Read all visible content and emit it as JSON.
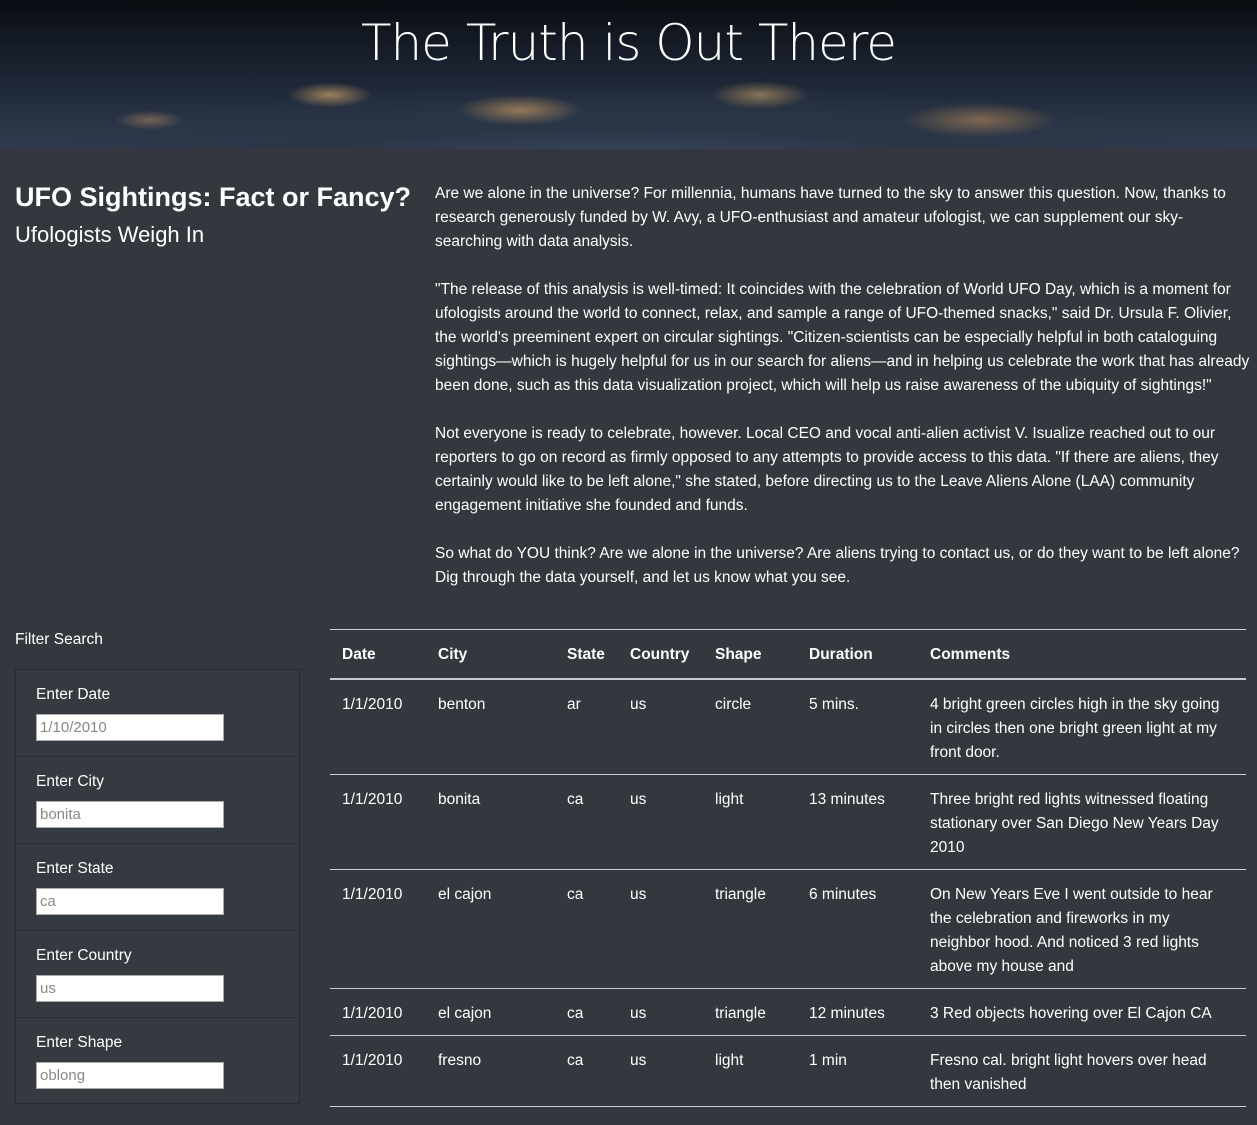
{
  "hero": {
    "title": "The Truth is Out There"
  },
  "article": {
    "title": "UFO Sightings: Fact or Fancy?",
    "subtitle": "Ufologists Weigh In",
    "paragraphs": [
      "Are we alone in the universe? For millennia, humans have turned to the sky to answer this question. Now, thanks to research generously funded by W. Avy, a UFO-enthusiast and amateur ufologist, we can supplement our sky-searching with data analysis.",
      "\"The release of this analysis is well-timed: It coincides with the celebration of World UFO Day, which is a moment for ufologists around the world to connect, relax, and sample a range of UFO-themed snacks,\" said Dr. Ursula F. Olivier, the world's preeminent expert on circular sightings. \"Citizen-scientists can be especially helpful in both cataloguing sightings—which is hugely helpful for us in our search for aliens—and in helping us celebrate the work that has already been done, such as this data visualization project, which will help us raise awareness of the ubiquity of sightings!\"",
      "Not everyone is ready to celebrate, however. Local CEO and vocal anti-alien activist V. Isualize reached out to our reporters to go on record as firmly opposed to any attempts to provide access to this data. \"If there are aliens, they certainly would like to be left alone,\" she stated, before directing us to the Leave Aliens Alone (LAA) community engagement initiative she founded and funds.",
      "So what do YOU think? Are we alone in the universe? Are aliens trying to contact us, or do they want to be left alone? Dig through the data yourself, and let us know what you see."
    ]
  },
  "filters": {
    "heading": "Filter Search",
    "items": [
      {
        "label": "Enter Date",
        "placeholder": "1/10/2010"
      },
      {
        "label": "Enter City",
        "placeholder": "bonita"
      },
      {
        "label": "Enter State",
        "placeholder": "ca"
      },
      {
        "label": "Enter Country",
        "placeholder": "us"
      },
      {
        "label": "Enter Shape",
        "placeholder": "oblong"
      }
    ]
  },
  "table": {
    "headers": [
      "Date",
      "City",
      "State",
      "Country",
      "Shape",
      "Duration",
      "Comments"
    ],
    "rows": [
      [
        "1/1/2010",
        "benton",
        "ar",
        "us",
        "circle",
        "5 mins.",
        "4 bright green circles high in the sky going in circles then one bright green light at my front door."
      ],
      [
        "1/1/2010",
        "bonita",
        "ca",
        "us",
        "light",
        "13 minutes",
        "Three bright red lights witnessed floating stationary over San Diego New Years Day 2010"
      ],
      [
        "1/1/2010",
        "el cajon",
        "ca",
        "us",
        "triangle",
        "6 minutes",
        "On New Years Eve I went outside to hear the celebration and fireworks in my neighbor hood. And noticed 3 red lights above my house and"
      ],
      [
        "1/1/2010",
        "el cajon",
        "ca",
        "us",
        "triangle",
        "12 minutes",
        "3 Red objects hovering over El Cajon CA"
      ],
      [
        "1/1/2010",
        "fresno",
        "ca",
        "us",
        "light",
        "1 min",
        "Fresno cal. bright light hovers over head then vanished"
      ]
    ]
  }
}
